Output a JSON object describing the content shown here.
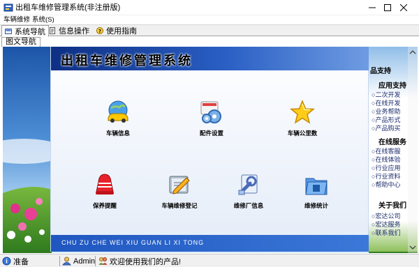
{
  "window": {
    "title": "出租车维修管理系统(非注册版)"
  },
  "menubar": {
    "items": [
      "车辆维修",
      "系统(S)"
    ]
  },
  "tabs": [
    {
      "label": "系统导航",
      "icon": "navigation-icon",
      "active": true
    },
    {
      "label": "信息操作",
      "icon": "document-icon",
      "active": false
    },
    {
      "label": "使用指南",
      "icon": "help-icon",
      "active": false
    }
  ],
  "subtab": {
    "label": "图文导航"
  },
  "panel": {
    "title": "出租车维修管理系统",
    "footer": "CHU ZU CHE WEI XIU GUAN LI XI TONG"
  },
  "nav_items": [
    {
      "label": "车辆信息",
      "icon": "car-globe-icon"
    },
    {
      "label": "配件设置",
      "icon": "gears-icon"
    },
    {
      "label": "车辆公里数",
      "icon": "star-icon"
    },
    {
      "label": "保养提醒",
      "icon": "alarm-bell-icon"
    },
    {
      "label": "车辆维修登记",
      "icon": "edit-document-icon"
    },
    {
      "label": "维修厂信息",
      "icon": "wrench-icon"
    },
    {
      "label": "维修统计",
      "icon": "folder-icon"
    }
  ],
  "sidebar": {
    "partial_heading": "品支持",
    "sections": [
      {
        "heading": "应用支持",
        "items": [
          "二次开发",
          "在线开发",
          "业务帮助",
          "产品形式",
          "产品购买"
        ]
      },
      {
        "heading": "在线服务",
        "items": [
          "在线客服",
          "在线体验",
          "行业应用",
          "行业资料",
          "帮助中心"
        ]
      },
      {
        "heading": "关于我们",
        "items": [
          "宏达公司",
          "宏达服务",
          "联系我们"
        ]
      }
    ]
  },
  "statusbar": {
    "status": "准备",
    "user": "Admin",
    "welcome": "欢迎使用我们的产品!"
  },
  "colors": {
    "panel_header": "#0d2f84",
    "panel_footer": "#1f56c0",
    "sky": "#2a6ab8",
    "grass": "#3d8f2a"
  }
}
